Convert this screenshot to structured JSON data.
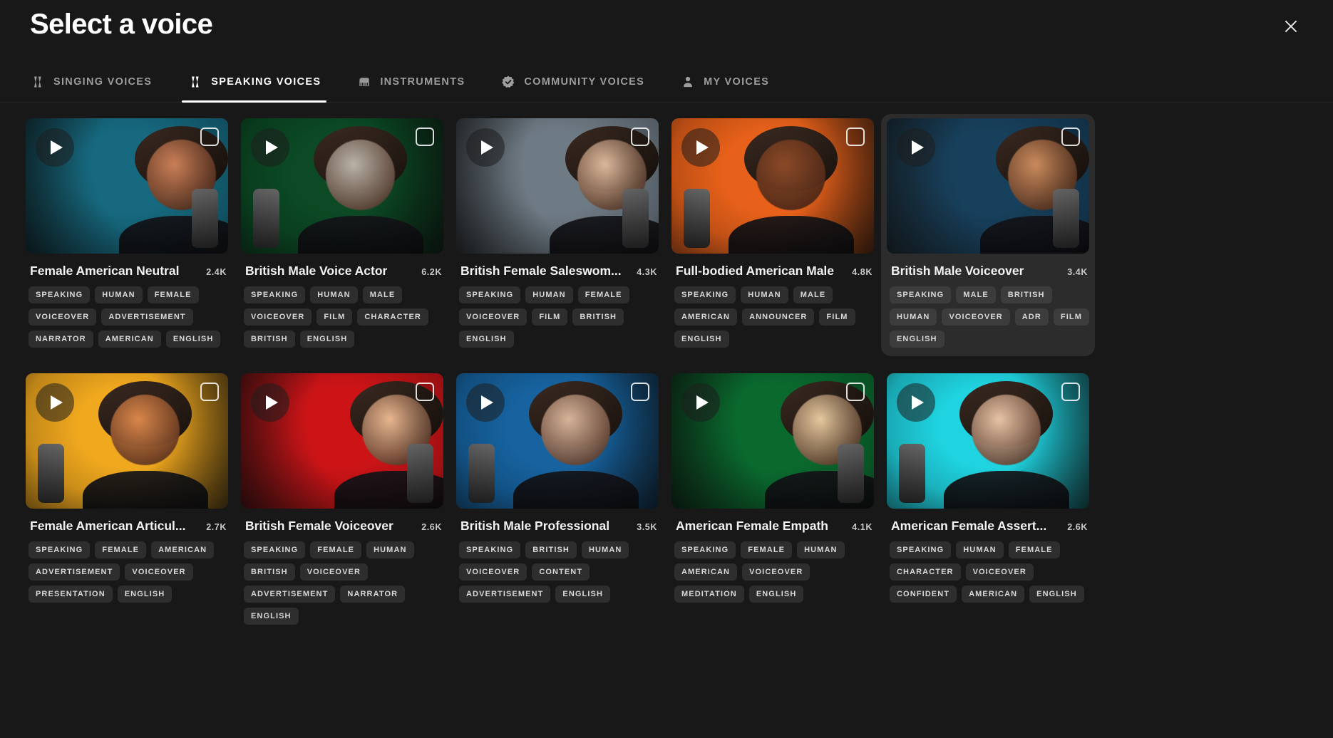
{
  "header": {
    "title": "Select a voice",
    "close_icon": "close-icon"
  },
  "tabs": [
    {
      "label": "SINGING VOICES",
      "icon": "singing-voices-icon",
      "active": false
    },
    {
      "label": "SPEAKING VOICES",
      "icon": "speaking-voices-icon",
      "active": true
    },
    {
      "label": "INSTRUMENTS",
      "icon": "piano-icon",
      "active": false
    },
    {
      "label": "COMMUNITY VOICES",
      "icon": "verified-badge-icon",
      "active": false
    },
    {
      "label": "MY VOICES",
      "icon": "person-icon",
      "active": false
    }
  ],
  "cards": [
    {
      "title": "Female American Neutral",
      "count": "2.4K",
      "hovered": false,
      "thumb_color": "#16697f",
      "thumb_accent": "#c97f57",
      "tags": [
        "SPEAKING",
        "HUMAN",
        "FEMALE",
        "VOICEOVER",
        "ADVERTISEMENT",
        "NARRATOR",
        "AMERICAN",
        "ENGLISH"
      ]
    },
    {
      "title": "British Male Voice Actor",
      "count": "6.2K",
      "hovered": false,
      "thumb_color": "#0b4a24",
      "thumb_accent": "#b9b2a6",
      "tags": [
        "SPEAKING",
        "HUMAN",
        "MALE",
        "VOICEOVER",
        "FILM",
        "CHARACTER",
        "BRITISH",
        "ENGLISH"
      ]
    },
    {
      "title": "British Female Saleswom...",
      "count": "4.3K",
      "hovered": false,
      "thumb_color": "#6e7a84",
      "thumb_accent": "#d9b79a",
      "tags": [
        "SPEAKING",
        "HUMAN",
        "FEMALE",
        "VOICEOVER",
        "FILM",
        "BRITISH",
        "ENGLISH"
      ]
    },
    {
      "title": "Full-bodied American Male",
      "count": "4.8K",
      "hovered": false,
      "thumb_color": "#e8611a",
      "thumb_accent": "#8a4a28",
      "tags": [
        "SPEAKING",
        "HUMAN",
        "MALE",
        "AMERICAN",
        "ANNOUNCER",
        "FILM",
        "ENGLISH"
      ]
    },
    {
      "title": "British Male Voiceover",
      "count": "3.4K",
      "hovered": true,
      "thumb_color": "#17405c",
      "thumb_accent": "#c98a5c",
      "tags": [
        "SPEAKING",
        "MALE",
        "BRITISH",
        "HUMAN",
        "VOICEOVER",
        "ADR",
        "FILM",
        "ENGLISH"
      ]
    },
    {
      "title": "Female American Articul...",
      "count": "2.7K",
      "hovered": false,
      "thumb_color": "#f0a81e",
      "thumb_accent": "#d9864a",
      "tags": [
        "SPEAKING",
        "FEMALE",
        "AMERICAN",
        "ADVERTISEMENT",
        "VOICEOVER",
        "PRESENTATION",
        "ENGLISH"
      ]
    },
    {
      "title": "British Female Voiceover",
      "count": "2.6K",
      "hovered": false,
      "thumb_color": "#cc1417",
      "thumb_accent": "#e7b58f",
      "tags": [
        "SPEAKING",
        "FEMALE",
        "HUMAN",
        "BRITISH",
        "VOICEOVER",
        "ADVERTISEMENT",
        "NARRATOR",
        "ENGLISH"
      ]
    },
    {
      "title": "British Male Professional",
      "count": "3.5K",
      "hovered": false,
      "thumb_color": "#1663a0",
      "thumb_accent": "#d6b49a",
      "tags": [
        "SPEAKING",
        "BRITISH",
        "HUMAN",
        "VOICEOVER",
        "CONTENT",
        "ADVERTISEMENT",
        "ENGLISH"
      ]
    },
    {
      "title": "American Female Empath",
      "count": "4.1K",
      "hovered": false,
      "thumb_color": "#0a6a2e",
      "thumb_accent": "#e3c79d",
      "tags": [
        "SPEAKING",
        "FEMALE",
        "HUMAN",
        "AMERICAN",
        "VOICEOVER",
        "MEDITATION",
        "ENGLISH"
      ]
    },
    {
      "title": "American Female Assert...",
      "count": "2.6K",
      "hovered": false,
      "thumb_color": "#1fd3e0",
      "thumb_accent": "#e6c2a5",
      "tags": [
        "SPEAKING",
        "HUMAN",
        "FEMALE",
        "CHARACTER",
        "VOICEOVER",
        "CONFIDENT",
        "AMERICAN",
        "ENGLISH"
      ]
    }
  ]
}
